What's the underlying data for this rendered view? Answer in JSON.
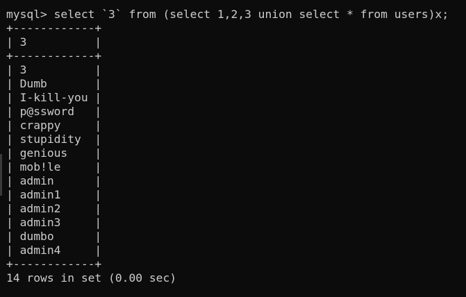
{
  "terminal": {
    "command_line": "mysql> select `3` from (select 1,2,3 union select * from users)x;",
    "border_line": "+------------+",
    "header_row": "| 3          |",
    "rows": [
      "| 3          |",
      "| Dumb       |",
      "| I-kill-you |",
      "| p@ssword   |",
      "| crappy     |",
      "| stupidity  |",
      "| genious    |",
      "| mob!le     |",
      "| admin      |",
      "| admin1     |",
      "| admin2     |",
      "| admin3     |",
      "| dumbo      |",
      "| admin4     |"
    ],
    "result_summary": "14 rows in set (0.00 sec)"
  }
}
